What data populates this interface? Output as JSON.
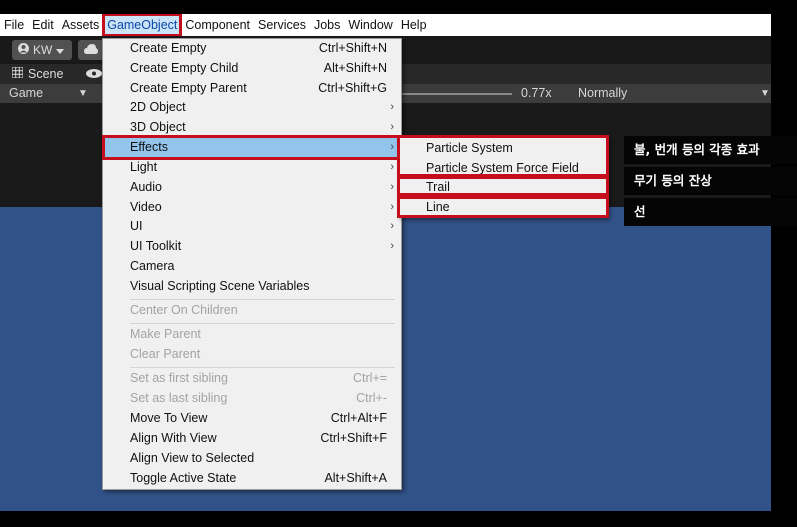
{
  "menubar": {
    "items": [
      "File",
      "Edit",
      "Assets",
      "GameObject",
      "Component",
      "Services",
      "Jobs",
      "Window",
      "Help"
    ],
    "active": "GameObject"
  },
  "toolbar": {
    "account": "KW"
  },
  "tabs": {
    "scene": "Scene"
  },
  "game_view": {
    "label": "Game",
    "scale": "0.77x",
    "play_mode": "Normally"
  },
  "gameobject_menu": {
    "items": [
      {
        "label": "Create Empty",
        "shortcut": "Ctrl+Shift+N"
      },
      {
        "label": "Create Empty Child",
        "shortcut": "Alt+Shift+N"
      },
      {
        "label": "Create Empty Parent",
        "shortcut": "Ctrl+Shift+G"
      },
      {
        "label": "2D Object"
      },
      {
        "label": "3D Object"
      },
      {
        "label": "Effects"
      },
      {
        "label": "Light"
      },
      {
        "label": "Audio"
      },
      {
        "label": "Video"
      },
      {
        "label": "UI"
      },
      {
        "label": "UI Toolkit"
      },
      {
        "label": "Camera"
      },
      {
        "label": "Visual Scripting Scene Variables"
      },
      {
        "label": "Center On Children"
      },
      {
        "label": "Make Parent"
      },
      {
        "label": "Clear Parent"
      },
      {
        "label": "Set as first sibling",
        "shortcut": "Ctrl+="
      },
      {
        "label": "Set as last sibling",
        "shortcut": "Ctrl+-"
      },
      {
        "label": "Move To View",
        "shortcut": "Ctrl+Alt+F"
      },
      {
        "label": "Align With View",
        "shortcut": "Ctrl+Shift+F"
      },
      {
        "label": "Align View to Selected"
      },
      {
        "label": "Toggle Active State",
        "shortcut": "Alt+Shift+A"
      }
    ]
  },
  "effects_submenu": {
    "items": [
      "Particle System",
      "Particle System Force Field",
      "Trail",
      "Line"
    ]
  },
  "callouts": [
    "불, 번개 등의 각종 효과",
    "무기 등의 잔상",
    "선"
  ],
  "colors": {
    "highlight_border": "#c40d1d",
    "menu_highlight": "#92c4ec",
    "scene_blue": "#315288"
  },
  "icons": [
    "account-icon",
    "cloud-icon",
    "scene-icon",
    "visibility-icon",
    "dropdown-arrow-icon",
    "submenu-arrow-icon"
  ]
}
